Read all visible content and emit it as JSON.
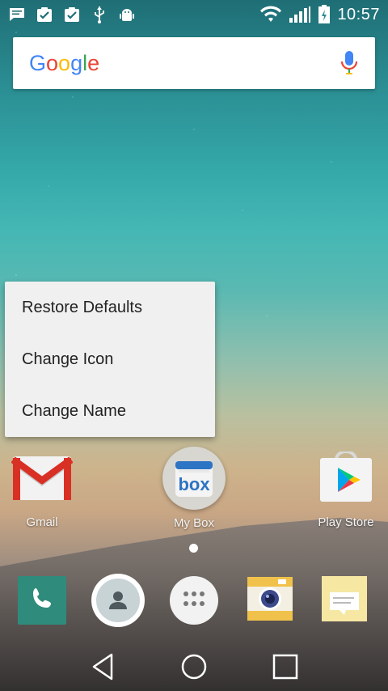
{
  "status_bar": {
    "time": "10:57",
    "left_icons": [
      "message-icon",
      "task-done-icon",
      "task-done-icon",
      "usb-icon",
      "android-debug-icon"
    ],
    "right_icons": [
      "wifi-icon",
      "signal-icon",
      "battery-charging-icon"
    ]
  },
  "search": {
    "logo_text": "Google",
    "mic_icon": "mic-icon"
  },
  "context_menu": {
    "items": [
      {
        "label": "Restore Defaults"
      },
      {
        "label": "Change Icon"
      },
      {
        "label": "Change Name"
      }
    ]
  },
  "home_apps": [
    {
      "label": "Gmail",
      "icon": "gmail-icon"
    },
    {
      "label": "My Box",
      "icon": "box-icon",
      "icon_text": "box"
    },
    {
      "label": "Play Store",
      "icon": "play-store-icon"
    }
  ],
  "dock": [
    {
      "icon": "phone-icon"
    },
    {
      "icon": "contacts-icon"
    },
    {
      "icon": "app-drawer-icon"
    },
    {
      "icon": "camera-icon"
    },
    {
      "icon": "notes-icon"
    }
  ],
  "nav": {
    "buttons": [
      "back-icon",
      "home-icon",
      "recents-icon"
    ]
  },
  "colors": {
    "google_blue": "#4285F4",
    "google_red": "#EA4335",
    "google_yellow": "#FBBC05",
    "google_green": "#34A853",
    "menu_bg": "#f0f0f0"
  }
}
